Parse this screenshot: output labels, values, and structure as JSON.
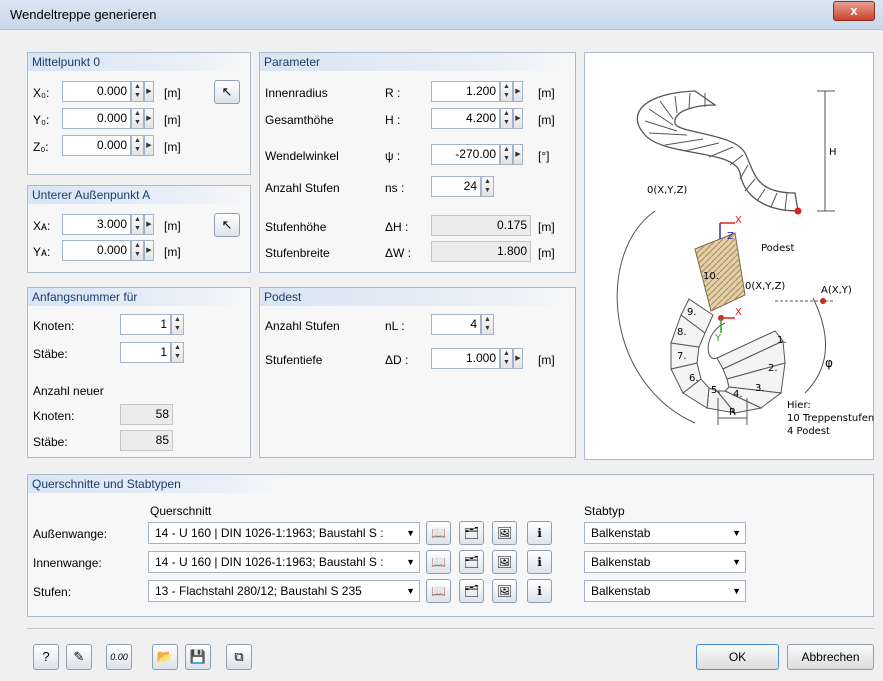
{
  "window": {
    "title": "Wendeltreppe generieren",
    "close": "x"
  },
  "mittelpunkt": {
    "title": "Mittelpunkt 0",
    "rows": [
      {
        "label": "X₀:",
        "value": "0.000",
        "unit": "[m]"
      },
      {
        "label": "Y₀:",
        "value": "0.000",
        "unit": "[m]"
      },
      {
        "label": "Z₀:",
        "value": "0.000",
        "unit": "[m]"
      }
    ]
  },
  "aussenpunkt": {
    "title": "Unterer Außenpunkt A",
    "rows": [
      {
        "label": "Xᴀ:",
        "value": "3.000",
        "unit": "[m]"
      },
      {
        "label": "Yᴀ:",
        "value": "0.000",
        "unit": "[m]"
      }
    ]
  },
  "anfangsnummer": {
    "title": "Anfangsnummer für",
    "knoten_label": "Knoten:",
    "knoten_value": "1",
    "staebe_label": "Stäbe:",
    "staebe_value": "1",
    "anzahl_title": "Anzahl neuer",
    "neu_knoten_label": "Knoten:",
    "neu_knoten_value": "58",
    "neu_staebe_label": "Stäbe:",
    "neu_staebe_value": "85"
  },
  "parameter": {
    "title": "Parameter",
    "innenradius": {
      "label": "Innenradius",
      "sym": "R :",
      "value": "1.200",
      "unit": "[m]"
    },
    "gesamthoehe": {
      "label": "Gesamthöhe",
      "sym": "H :",
      "value": "4.200",
      "unit": "[m]"
    },
    "wendelwinkel": {
      "label": "Wendelwinkel",
      "sym": "ψ :",
      "value": "-270.00",
      "unit": "[°]"
    },
    "anzahl": {
      "label": "Anzahl Stufen",
      "sym": "ns :",
      "value": "24"
    },
    "stufenhoehe": {
      "label": "Stufenhöhe",
      "sym": "ΔH :",
      "value": "0.175",
      "unit": "[m]"
    },
    "stufenbreite": {
      "label": "Stufenbreite",
      "sym": "ΔW :",
      "value": "1.800",
      "unit": "[m]"
    }
  },
  "podest": {
    "title": "Podest",
    "anzahl": {
      "label": "Anzahl Stufen",
      "sym": "nL :",
      "value": "4"
    },
    "tiefe": {
      "label": "Stufentiefe",
      "sym": "ΔD :",
      "value": "1.000",
      "unit": "[m]"
    }
  },
  "diagram": {
    "label_0": "0(X,Y,Z)",
    "label_0b": "0(X,Y,Z)",
    "label_a": "A(X,Y)",
    "label_podest": "Podest",
    "label_h": "H",
    "label_r": "R",
    "label_phi": "φ",
    "label_x": "X",
    "label_x2": "X",
    "label_z": "Z",
    "label_y": "Y",
    "steps": [
      "1.",
      "2.",
      "3.",
      "4.",
      "5.",
      "6.",
      "7.",
      "8.",
      "9.",
      "10."
    ],
    "note1": "Hier:",
    "note2": "10 Treppenstufen",
    "note3": "4 Podest"
  },
  "querschnitte": {
    "title": "Querschnitte und Stabtypen",
    "col_qs": "Querschnitt",
    "col_st": "Stabtyp",
    "rows": [
      {
        "label": "Außenwange:",
        "qs": "14 - U 160 | DIN 1026-1:1963; Baustahl S :",
        "st": "Balkenstab"
      },
      {
        "label": "Innenwange:",
        "qs": "14 - U 160 | DIN 1026-1:1963; Baustahl S :",
        "st": "Balkenstab"
      },
      {
        "label": "Stufen:",
        "qs": "13 - Flachstahl 280/12; Baustahl S 235",
        "st": "Balkenstab"
      }
    ]
  },
  "footer": {
    "ok": "OK",
    "cancel": "Abbrechen",
    "units_icon_text": "0.00"
  }
}
